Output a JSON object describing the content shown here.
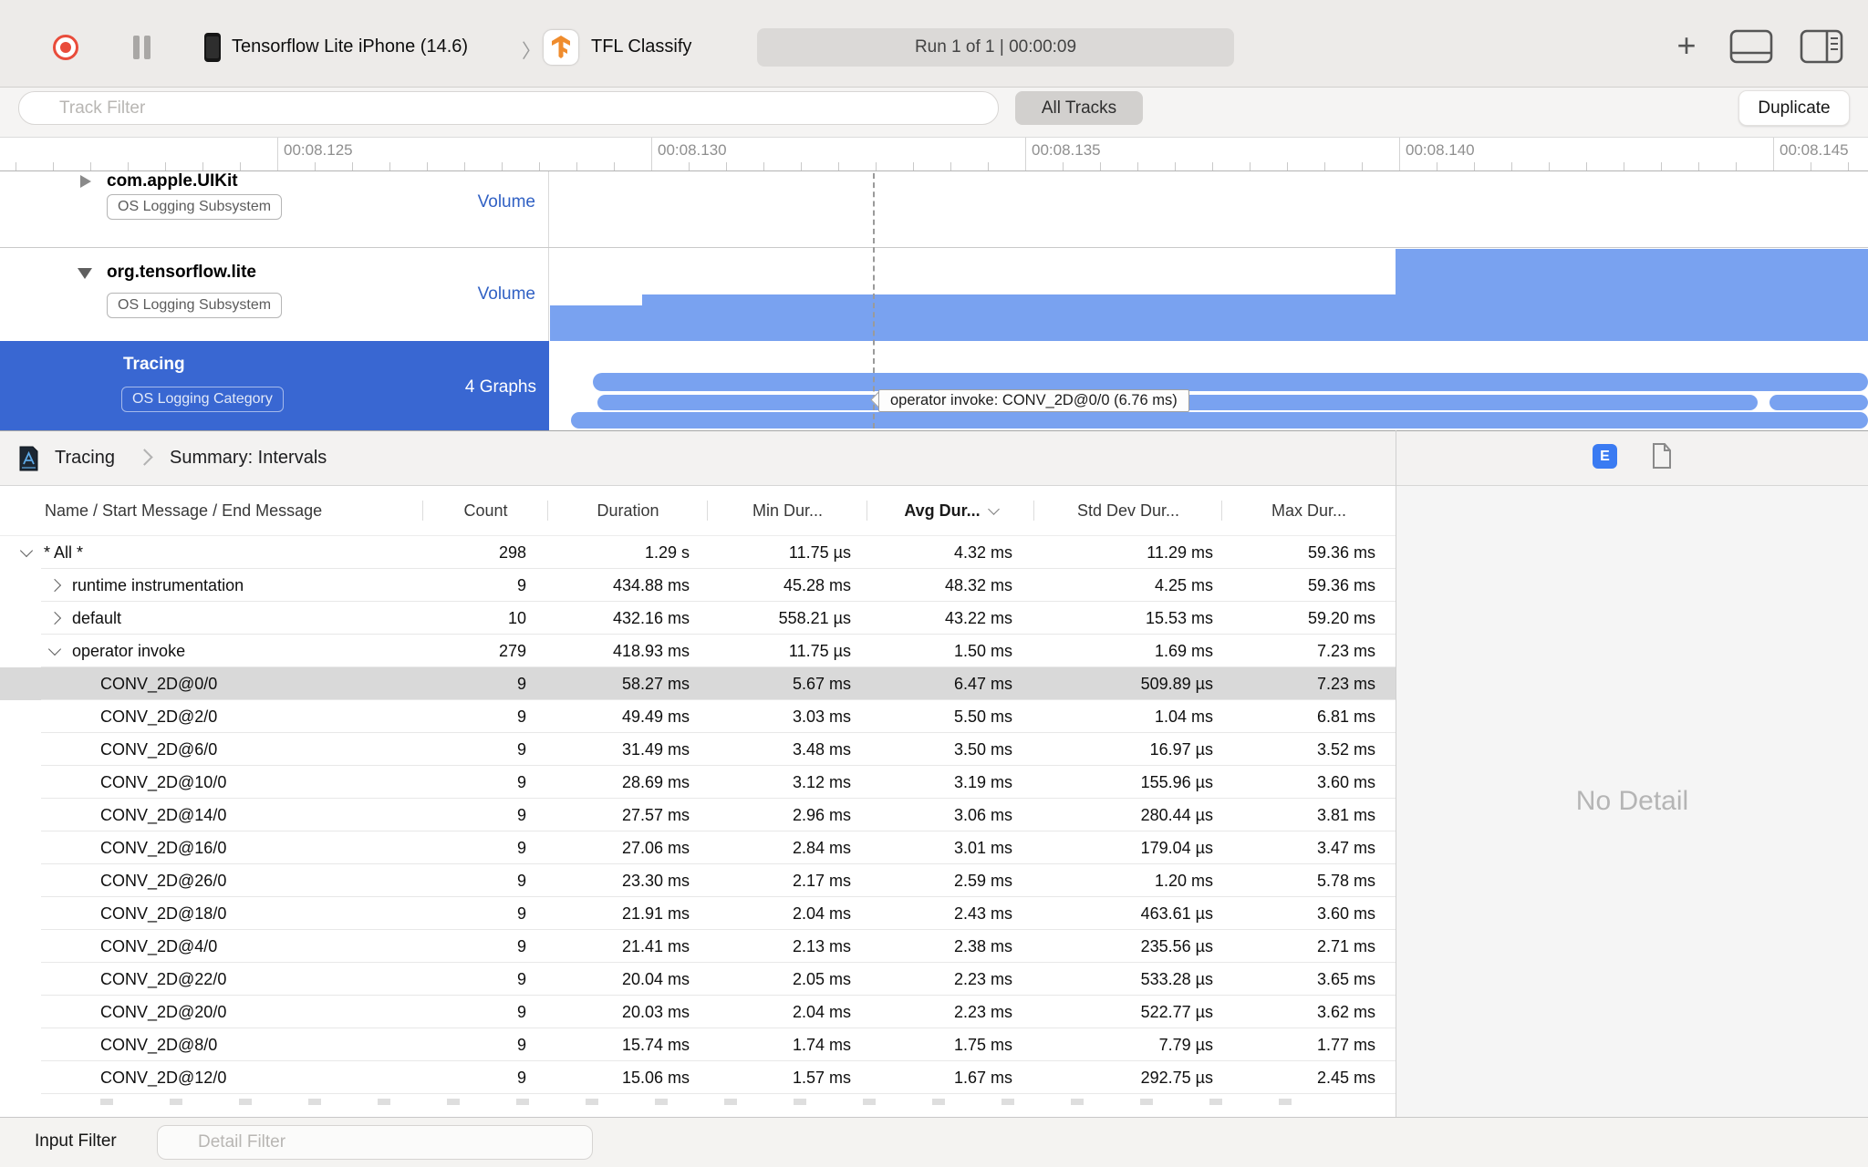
{
  "toolbar": {
    "device_name": "Tensorflow Lite iPhone (14.6)",
    "separator": "〉",
    "app_name": "TFL Classify",
    "run_info": "Run 1 of 1  |  00:00:09"
  },
  "filter_bar": {
    "track_filter_placeholder": "Track Filter",
    "all_tracks_label": "All Tracks",
    "duplicate_label": "Duplicate"
  },
  "ruler": {
    "tick_labels": [
      "00:08.125",
      "00:08.130",
      "00:08.135",
      "00:08.140",
      "00:08.145"
    ]
  },
  "tracks": [
    {
      "name": "com.apple.UIKit",
      "badge": "OS Logging Subsystem",
      "meta": "Volume",
      "disclosure": "collapsed",
      "selected": false
    },
    {
      "name": "org.tensorflow.lite",
      "badge": "OS Logging Subsystem",
      "meta": "Volume",
      "disclosure": "expanded",
      "selected": false
    },
    {
      "name": "Tracing",
      "badge": "OS Logging Category",
      "meta": "4 Graphs",
      "disclosure": "none",
      "selected": true
    }
  ],
  "tooltip_text": "operator invoke: CONV_2D@0/0 (6.76 ms)",
  "detail_header": {
    "breadcrumb_root": "Tracing",
    "breadcrumb_view": "Summary: Intervals",
    "extended_badge": "E"
  },
  "table": {
    "columns": [
      "Name / Start Message / End Message",
      "Count",
      "Duration",
      "Min Dur...",
      "Avg Dur...",
      "Std Dev Dur...",
      "Max Dur..."
    ],
    "sorted_column": "Avg Dur...",
    "sort_direction": "descending",
    "rows": [
      {
        "level": 0,
        "disclosure": "open",
        "name": "* All *",
        "count": "298",
        "duration": "1.29 s",
        "min": "11.75 µs",
        "avg": "4.32 ms",
        "std": "11.29 ms",
        "max": "59.36 ms",
        "selected": false
      },
      {
        "level": 1,
        "disclosure": "closed",
        "name": "runtime instrumentation",
        "count": "9",
        "duration": "434.88 ms",
        "min": "45.28 ms",
        "avg": "48.32 ms",
        "std": "4.25 ms",
        "max": "59.36 ms",
        "selected": false
      },
      {
        "level": 1,
        "disclosure": "closed",
        "name": "default",
        "count": "10",
        "duration": "432.16 ms",
        "min": "558.21 µs",
        "avg": "43.22 ms",
        "std": "15.53 ms",
        "max": "59.20 ms",
        "selected": false
      },
      {
        "level": 1,
        "disclosure": "open",
        "name": "operator invoke",
        "count": "279",
        "duration": "418.93 ms",
        "min": "11.75 µs",
        "avg": "1.50 ms",
        "std": "1.69 ms",
        "max": "7.23 ms",
        "selected": false
      },
      {
        "level": 2,
        "disclosure": null,
        "name": "CONV_2D@0/0",
        "count": "9",
        "duration": "58.27 ms",
        "min": "5.67 ms",
        "avg": "6.47 ms",
        "std": "509.89 µs",
        "max": "7.23 ms",
        "selected": true
      },
      {
        "level": 2,
        "disclosure": null,
        "name": "CONV_2D@2/0",
        "count": "9",
        "duration": "49.49 ms",
        "min": "3.03 ms",
        "avg": "5.50 ms",
        "std": "1.04 ms",
        "max": "6.81 ms",
        "selected": false
      },
      {
        "level": 2,
        "disclosure": null,
        "name": "CONV_2D@6/0",
        "count": "9",
        "duration": "31.49 ms",
        "min": "3.48 ms",
        "avg": "3.50 ms",
        "std": "16.97 µs",
        "max": "3.52 ms",
        "selected": false
      },
      {
        "level": 2,
        "disclosure": null,
        "name": "CONV_2D@10/0",
        "count": "9",
        "duration": "28.69 ms",
        "min": "3.12 ms",
        "avg": "3.19 ms",
        "std": "155.96 µs",
        "max": "3.60 ms",
        "selected": false
      },
      {
        "level": 2,
        "disclosure": null,
        "name": "CONV_2D@14/0",
        "count": "9",
        "duration": "27.57 ms",
        "min": "2.96 ms",
        "avg": "3.06 ms",
        "std": "280.44 µs",
        "max": "3.81 ms",
        "selected": false
      },
      {
        "level": 2,
        "disclosure": null,
        "name": "CONV_2D@16/0",
        "count": "9",
        "duration": "27.06 ms",
        "min": "2.84 ms",
        "avg": "3.01 ms",
        "std": "179.04 µs",
        "max": "3.47 ms",
        "selected": false
      },
      {
        "level": 2,
        "disclosure": null,
        "name": "CONV_2D@26/0",
        "count": "9",
        "duration": "23.30 ms",
        "min": "2.17 ms",
        "avg": "2.59 ms",
        "std": "1.20 ms",
        "max": "5.78 ms",
        "selected": false
      },
      {
        "level": 2,
        "disclosure": null,
        "name": "CONV_2D@18/0",
        "count": "9",
        "duration": "21.91 ms",
        "min": "2.04 ms",
        "avg": "2.43 ms",
        "std": "463.61 µs",
        "max": "3.60 ms",
        "selected": false
      },
      {
        "level": 2,
        "disclosure": null,
        "name": "CONV_2D@4/0",
        "count": "9",
        "duration": "21.41 ms",
        "min": "2.13 ms",
        "avg": "2.38 ms",
        "std": "235.56 µs",
        "max": "2.71 ms",
        "selected": false
      },
      {
        "level": 2,
        "disclosure": null,
        "name": "CONV_2D@22/0",
        "count": "9",
        "duration": "20.04 ms",
        "min": "2.05 ms",
        "avg": "2.23 ms",
        "std": "533.28 µs",
        "max": "3.65 ms",
        "selected": false
      },
      {
        "level": 2,
        "disclosure": null,
        "name": "CONV_2D@20/0",
        "count": "9",
        "duration": "20.03 ms",
        "min": "2.04 ms",
        "avg": "2.23 ms",
        "std": "522.77 µs",
        "max": "3.62 ms",
        "selected": false
      },
      {
        "level": 2,
        "disclosure": null,
        "name": "CONV_2D@8/0",
        "count": "9",
        "duration": "15.74 ms",
        "min": "1.74 ms",
        "avg": "1.75 ms",
        "std": "7.79 µs",
        "max": "1.77 ms",
        "selected": false
      },
      {
        "level": 2,
        "disclosure": null,
        "name": "CONV_2D@12/0",
        "count": "9",
        "duration": "15.06 ms",
        "min": "1.57 ms",
        "avg": "1.67 ms",
        "std": "292.75 µs",
        "max": "2.45 ms",
        "selected": false
      }
    ]
  },
  "detail_pane": {
    "empty_text": "No Detail"
  },
  "bottom_bar": {
    "label": "Input Filter",
    "detail_filter_placeholder": "Detail Filter"
  },
  "colors": {
    "selected_track_blue": "#3967d2",
    "graph_bar_blue": "#79a2f0",
    "volume_link_blue": "#3161c4",
    "record_red": "#e94c3b",
    "extended_badge_blue": "#3a7bf2",
    "selected_row_gray": "#d9d9d9"
  },
  "icons": [
    "record-icon",
    "pause-icon",
    "iphone-icon",
    "tensorflow-app-icon",
    "plus-icon",
    "split-bottom-icon",
    "split-right-icon",
    "filter-icon",
    "instrument-icon",
    "chevron-icons",
    "document-icon"
  ]
}
